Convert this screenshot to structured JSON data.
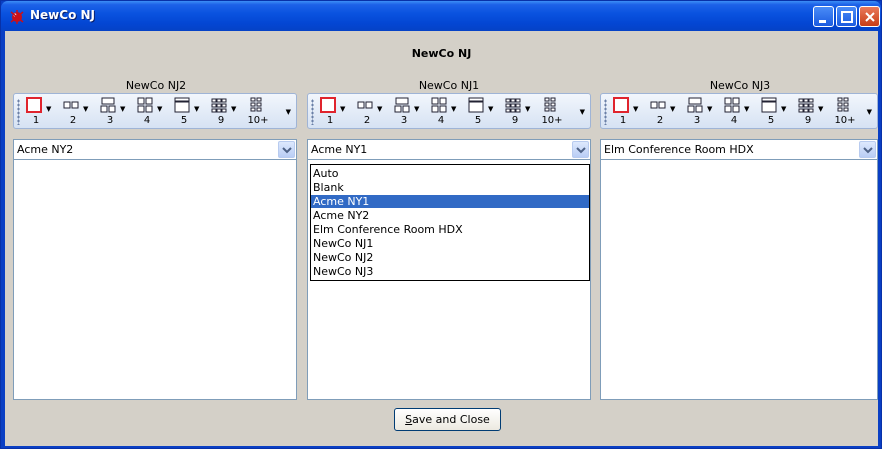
{
  "window": {
    "title": "NewCo NJ"
  },
  "header": {
    "title": "NewCo NJ"
  },
  "panels": [
    {
      "label": "NewCo NJ2",
      "selected": "Acme NY2"
    },
    {
      "label": "NewCo NJ1",
      "selected": "Acme NY1"
    },
    {
      "label": "NewCo NJ3",
      "selected": "Elm Conference Room HDX"
    }
  ],
  "layout_tools": [
    "1",
    "2",
    "3",
    "4",
    "5",
    "9",
    "10+"
  ],
  "dropdown": {
    "options": [
      "Auto",
      "Blank",
      "Acme NY1",
      "Acme NY2",
      "Elm Conference Room HDX",
      "NewCo NJ1",
      "NewCo NJ2",
      "NewCo NJ3"
    ],
    "selected_index": 2
  },
  "footer": {
    "save_label": "Save and Close",
    "save_accel": "S",
    "save_rest": "ave and Close"
  },
  "colors": {
    "titlebar": "#0a53e0",
    "client": "#d4d0c8",
    "selection": "#316ac5"
  }
}
